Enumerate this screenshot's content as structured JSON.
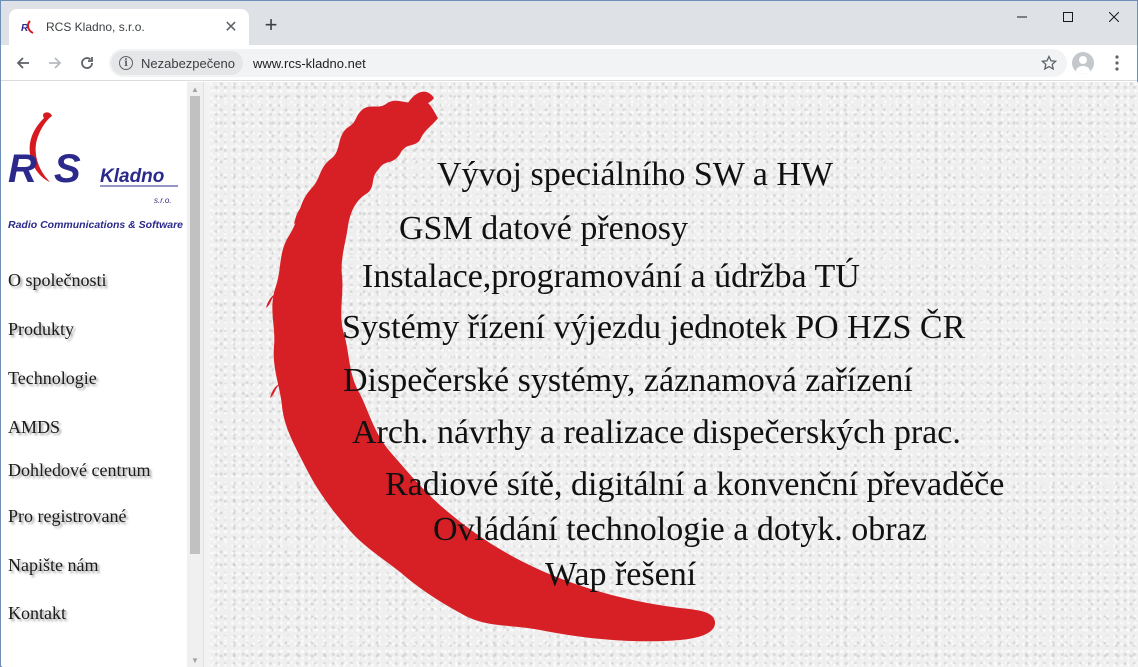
{
  "browser": {
    "tab_title": "RCS Kladno, s.r.o.",
    "security_label": "Nezabezpečeno",
    "url": "www.rcs-kladno.net"
  },
  "logo": {
    "rcs_text": "RCS",
    "kladno_text": "Kladno",
    "sro_text": "s.r.o.",
    "tagline": "Radio Communications & Software",
    "colors": {
      "red": "#d71920",
      "blue": "#2b2a8c"
    }
  },
  "sidebar": {
    "items": [
      {
        "label": "O společnosti"
      },
      {
        "label": "Produkty"
      },
      {
        "label": "Technologie"
      },
      {
        "label": "AMDS"
      },
      {
        "label": "Dohledové centrum"
      },
      {
        "label": "Pro registrované"
      },
      {
        "label": "Napište nám"
      },
      {
        "label": "Kontakt"
      }
    ]
  },
  "services": [
    "Vývoj speciálního SW a HW",
    "GSM datové přenosy",
    "Instalace,programování a údržba TÚ",
    "Systémy řízení výjezdu jednotek PO HZS ČR",
    "Dispečerské systémy, záznamová zařízení",
    "Arch. návrhy a realizace dispečerských prac.",
    "Radiové sítě, digitální a konvenční převaděče",
    "Ovládání technologie a dotyk. obraz",
    "Wap řešení"
  ],
  "colors": {
    "swoosh": "#d71f26",
    "page_bg": "#efefef"
  }
}
